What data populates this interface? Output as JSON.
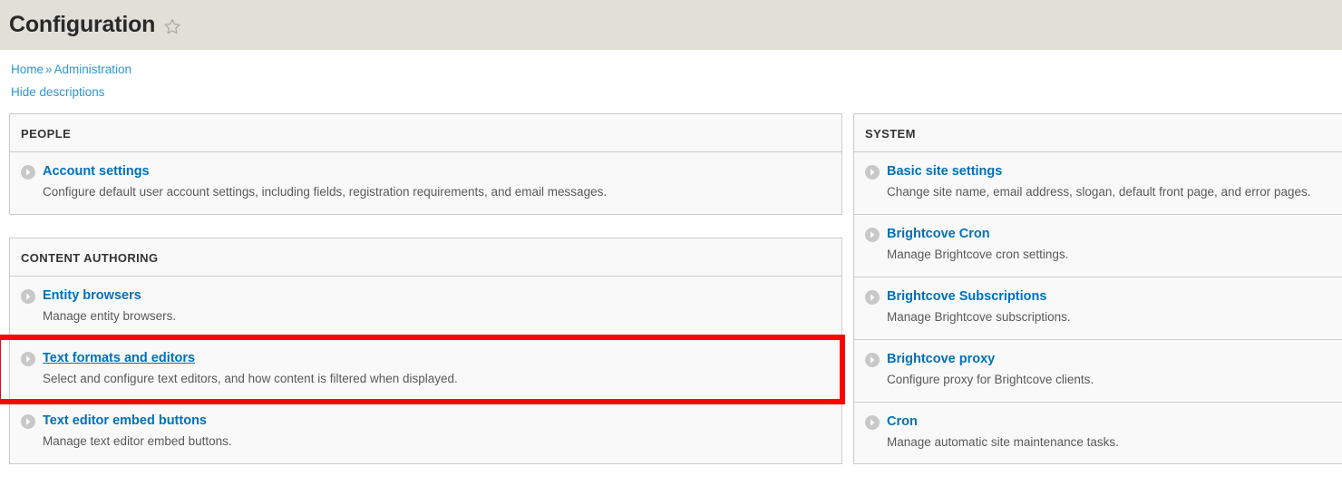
{
  "header": {
    "title": "Configuration",
    "star_icon": "star-outline-icon"
  },
  "breadcrumb": {
    "home": "Home",
    "separator": "»",
    "current": "Administration"
  },
  "actions": {
    "hide_descriptions": "Hide descriptions"
  },
  "colors": {
    "header_bar": "#e0e0d8",
    "link_blue": "#0071b8",
    "breadcrumb_blue": "#2f96d4",
    "panel_bg": "#f9f9f9",
    "panel_border": "#cccccc",
    "description_text": "#595959",
    "highlight_red": "#fb0404"
  },
  "left_column": {
    "panels": [
      {
        "title": "PEOPLE",
        "items": [
          {
            "icon": "chevron-right-circle-icon",
            "label": "Account settings",
            "description": "Configure default user account settings, including fields, registration requirements, and email messages.",
            "hovered": false,
            "highlighted": false
          }
        ]
      },
      {
        "title": "CONTENT AUTHORING",
        "items": [
          {
            "icon": "chevron-right-circle-icon",
            "label": "Entity browsers",
            "description": "Manage entity browsers.",
            "hovered": false,
            "highlighted": false
          },
          {
            "icon": "chevron-right-circle-icon",
            "label": "Text formats and editors",
            "description": "Select and configure text editors, and how content is filtered when displayed.",
            "hovered": true,
            "highlighted": true
          },
          {
            "icon": "chevron-right-circle-icon",
            "label": "Text editor embed buttons",
            "description": "Manage text editor embed buttons.",
            "hovered": false,
            "highlighted": false
          }
        ]
      }
    ]
  },
  "right_column": {
    "panels": [
      {
        "title": "SYSTEM",
        "items": [
          {
            "icon": "chevron-right-circle-icon",
            "label": "Basic site settings",
            "description": "Change site name, email address, slogan, default front page, and error pages.",
            "hovered": false,
            "highlighted": false
          },
          {
            "icon": "chevron-right-circle-icon",
            "label": "Brightcove Cron",
            "description": "Manage Brightcove cron settings.",
            "hovered": false,
            "highlighted": false
          },
          {
            "icon": "chevron-right-circle-icon",
            "label": "Brightcove Subscriptions",
            "description": "Manage Brightcove subscriptions.",
            "hovered": false,
            "highlighted": false
          },
          {
            "icon": "chevron-right-circle-icon",
            "label": "Brightcove proxy",
            "description": "Configure proxy for Brightcove clients.",
            "hovered": false,
            "highlighted": false
          },
          {
            "icon": "chevron-right-circle-icon",
            "label": "Cron",
            "description": "Manage automatic site maintenance tasks.",
            "hovered": false,
            "highlighted": false
          }
        ]
      }
    ]
  }
}
